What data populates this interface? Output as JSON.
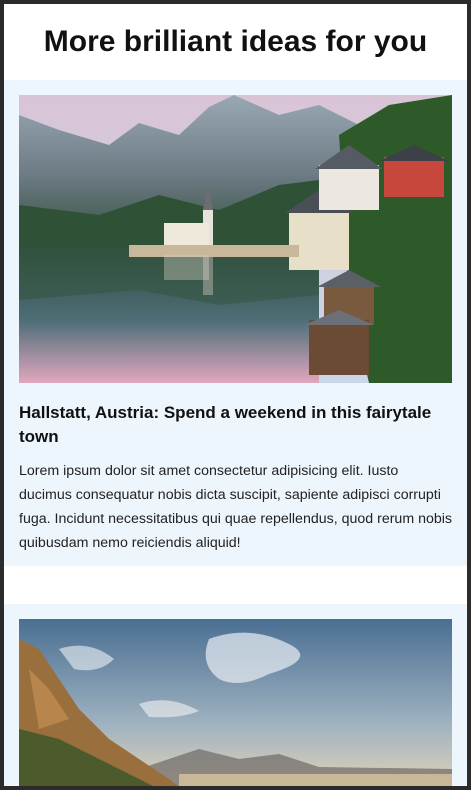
{
  "page": {
    "heading": "More brilliant ideas for you"
  },
  "cards": [
    {
      "image": "hallstatt-lake-village-photo",
      "title": "Hallstatt, Austria: Spend a weekend in this fairytale town",
      "text": "Lorem ipsum dolor sit amet consectetur adipisicing elit. Iusto ducimus consequatur nobis dicta suscipit, sapiente adipisci corrupti fuga. Incidunt necessitatibus qui quae repellendus, quod rerum nobis quibusdam nemo reiciendis aliquid!"
    },
    {
      "image": "coastal-cliff-sunset-photo",
      "title": "",
      "text": ""
    }
  ]
}
